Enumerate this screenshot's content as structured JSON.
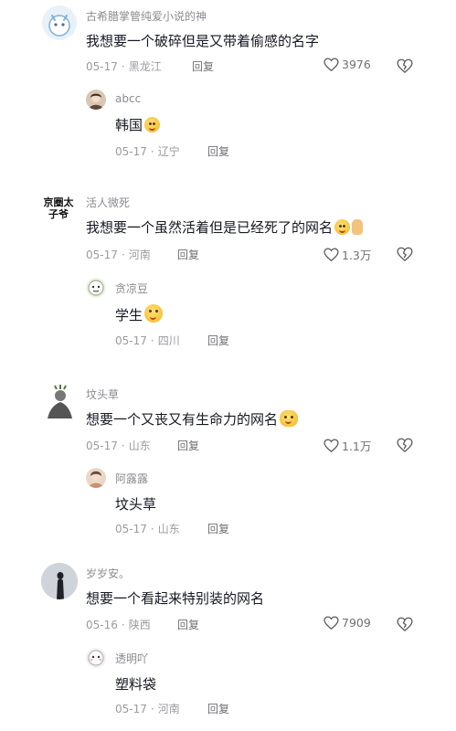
{
  "threads": [
    {
      "comment": {
        "username": "古希腊掌管纯爱小说的神",
        "text": "我想要一个破碎但是又带着偷感的名字",
        "date": "05-17",
        "region": "黑龙江",
        "reply": "回复",
        "likes": "3976"
      },
      "reply": {
        "username": "abcc",
        "text": "韩国",
        "date": "05-17",
        "region": "辽宁",
        "reply": "回复"
      }
    },
    {
      "comment": {
        "username": "活人微死",
        "avatar_text": "京圈太子爷",
        "text": "我想要一个虽然活着但是已经死了的网名",
        "date": "05-17",
        "region": "河南",
        "reply": "回复",
        "likes": "1.3万"
      },
      "reply": {
        "username": "贪凉豆",
        "text": "学生",
        "date": "05-17",
        "region": "四川",
        "reply": "回复"
      }
    },
    {
      "comment": {
        "username": "坟头草",
        "text": "想要一个又丧又有生命力的网名",
        "date": "05-17",
        "region": "山东",
        "reply": "回复",
        "likes": "1.1万"
      },
      "reply": {
        "username": "阿露露",
        "text": "坟头草",
        "date": "05-17",
        "region": "山东",
        "reply": "回复"
      }
    },
    {
      "comment": {
        "username": "岁岁安。",
        "text": "想要一个看起来特别装的网名",
        "date": "05-16",
        "region": "陕西",
        "reply": "回复",
        "likes": "7909"
      },
      "reply": {
        "username": "透明吖",
        "text": "塑料袋",
        "date": "05-17",
        "region": "河南",
        "reply": "回复"
      }
    }
  ],
  "icons": {
    "like": "heart-outline-icon",
    "dislike": "broken-heart-icon"
  },
  "colors": {
    "text": "#161823",
    "secondary": "#9a9ba1",
    "username": "#8a8b91"
  }
}
